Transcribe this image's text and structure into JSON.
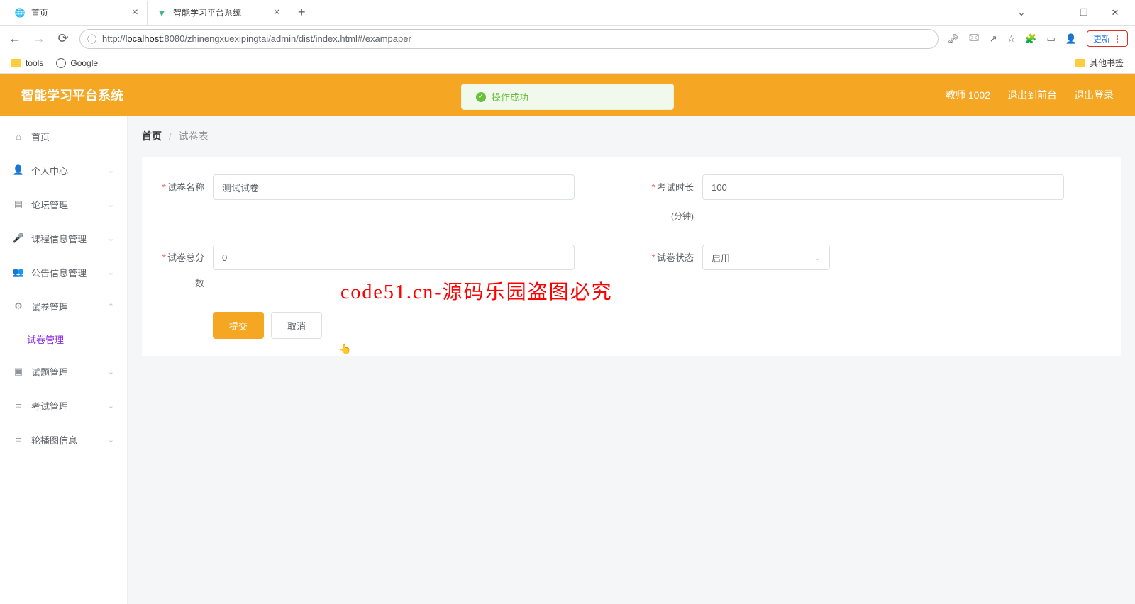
{
  "browser": {
    "tabs": [
      {
        "title": "首页",
        "icon": "globe"
      },
      {
        "title": "智能学习平台系统",
        "icon": "vue"
      }
    ],
    "url_prefix": "http://",
    "url_host": "localhost",
    "url_path": ":8080/zhinengxuexipingtai/admin/dist/index.html#/exampaper",
    "update_label": "更新",
    "bookmarks": {
      "tools": "tools",
      "google": "Google",
      "other": "其他书签"
    }
  },
  "header": {
    "title": "智能学习平台系统",
    "user": "教师 1002",
    "to_front": "退出到前台",
    "logout": "退出登录"
  },
  "toast": {
    "text": "操作成功"
  },
  "sidebar": {
    "home": "首页",
    "personal": "个人中心",
    "forum": "论坛管理",
    "course": "课程信息管理",
    "notice": "公告信息管理",
    "exam": "试卷管理",
    "exam_sub": "试卷管理",
    "question": "试题管理",
    "test": "考试管理",
    "carousel": "轮播图信息"
  },
  "breadcrumb": {
    "home": "首页",
    "current": "试卷表"
  },
  "form": {
    "name_label": "试卷名称",
    "name_value": "测试试卷",
    "duration_label": "考试时长",
    "duration_value": "100",
    "duration_unit": "(分钟)",
    "score_label": "试卷总分数",
    "score_value": "0",
    "status_label": "试卷状态",
    "status_value": "启用",
    "submit": "提交",
    "cancel": "取消"
  },
  "watermark": "code51.cn-源码乐园盗图必究",
  "wm_bg": "code51.cn"
}
